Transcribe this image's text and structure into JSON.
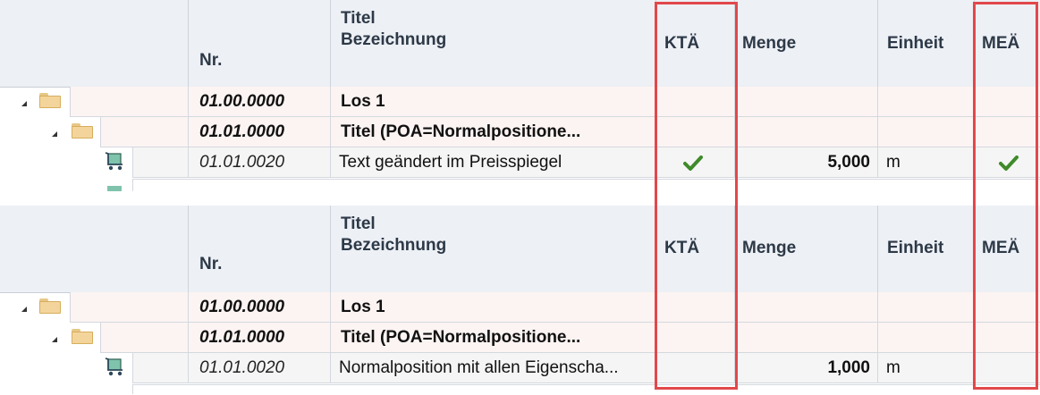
{
  "header": {
    "nr": "Nr.",
    "titel": "Titel",
    "bezeichnung": "Bezeichnung",
    "kta": "KTÄ",
    "menge": "Menge",
    "einheit": "Einheit",
    "mea": "MEÄ"
  },
  "grids": [
    {
      "rows": [
        {
          "nr": "01.00.0000",
          "bez": "Los 1"
        },
        {
          "nr": "01.01.0000",
          "bez": "Titel (POA=Normalpositione..."
        },
        {
          "nr": "01.01.0020",
          "bez": "Text geändert im Preisspiegel",
          "menge": "5,000",
          "einheit": "m",
          "kta_checked": true,
          "mea_checked": true
        }
      ]
    },
    {
      "rows": [
        {
          "nr": "01.00.0000",
          "bez": "Los 1"
        },
        {
          "nr": "01.01.0000",
          "bez": "Titel (POA=Normalpositione..."
        },
        {
          "nr": "01.01.0020",
          "bez": "Normalposition mit allen Eigenscha...",
          "menge": "1,000",
          "einheit": "m",
          "kta_checked": false,
          "mea_checked": false
        }
      ]
    }
  ],
  "icons": {
    "expand": "expand-triangle-icon",
    "folder": "folder-icon",
    "cart": "cart-icon",
    "check": "checkmark-icon"
  },
  "colors": {
    "header_bg": "#edf0f5",
    "group_bg": "#fcf4f3",
    "highlight": "#e2484b",
    "check": "#3f8a2a"
  }
}
